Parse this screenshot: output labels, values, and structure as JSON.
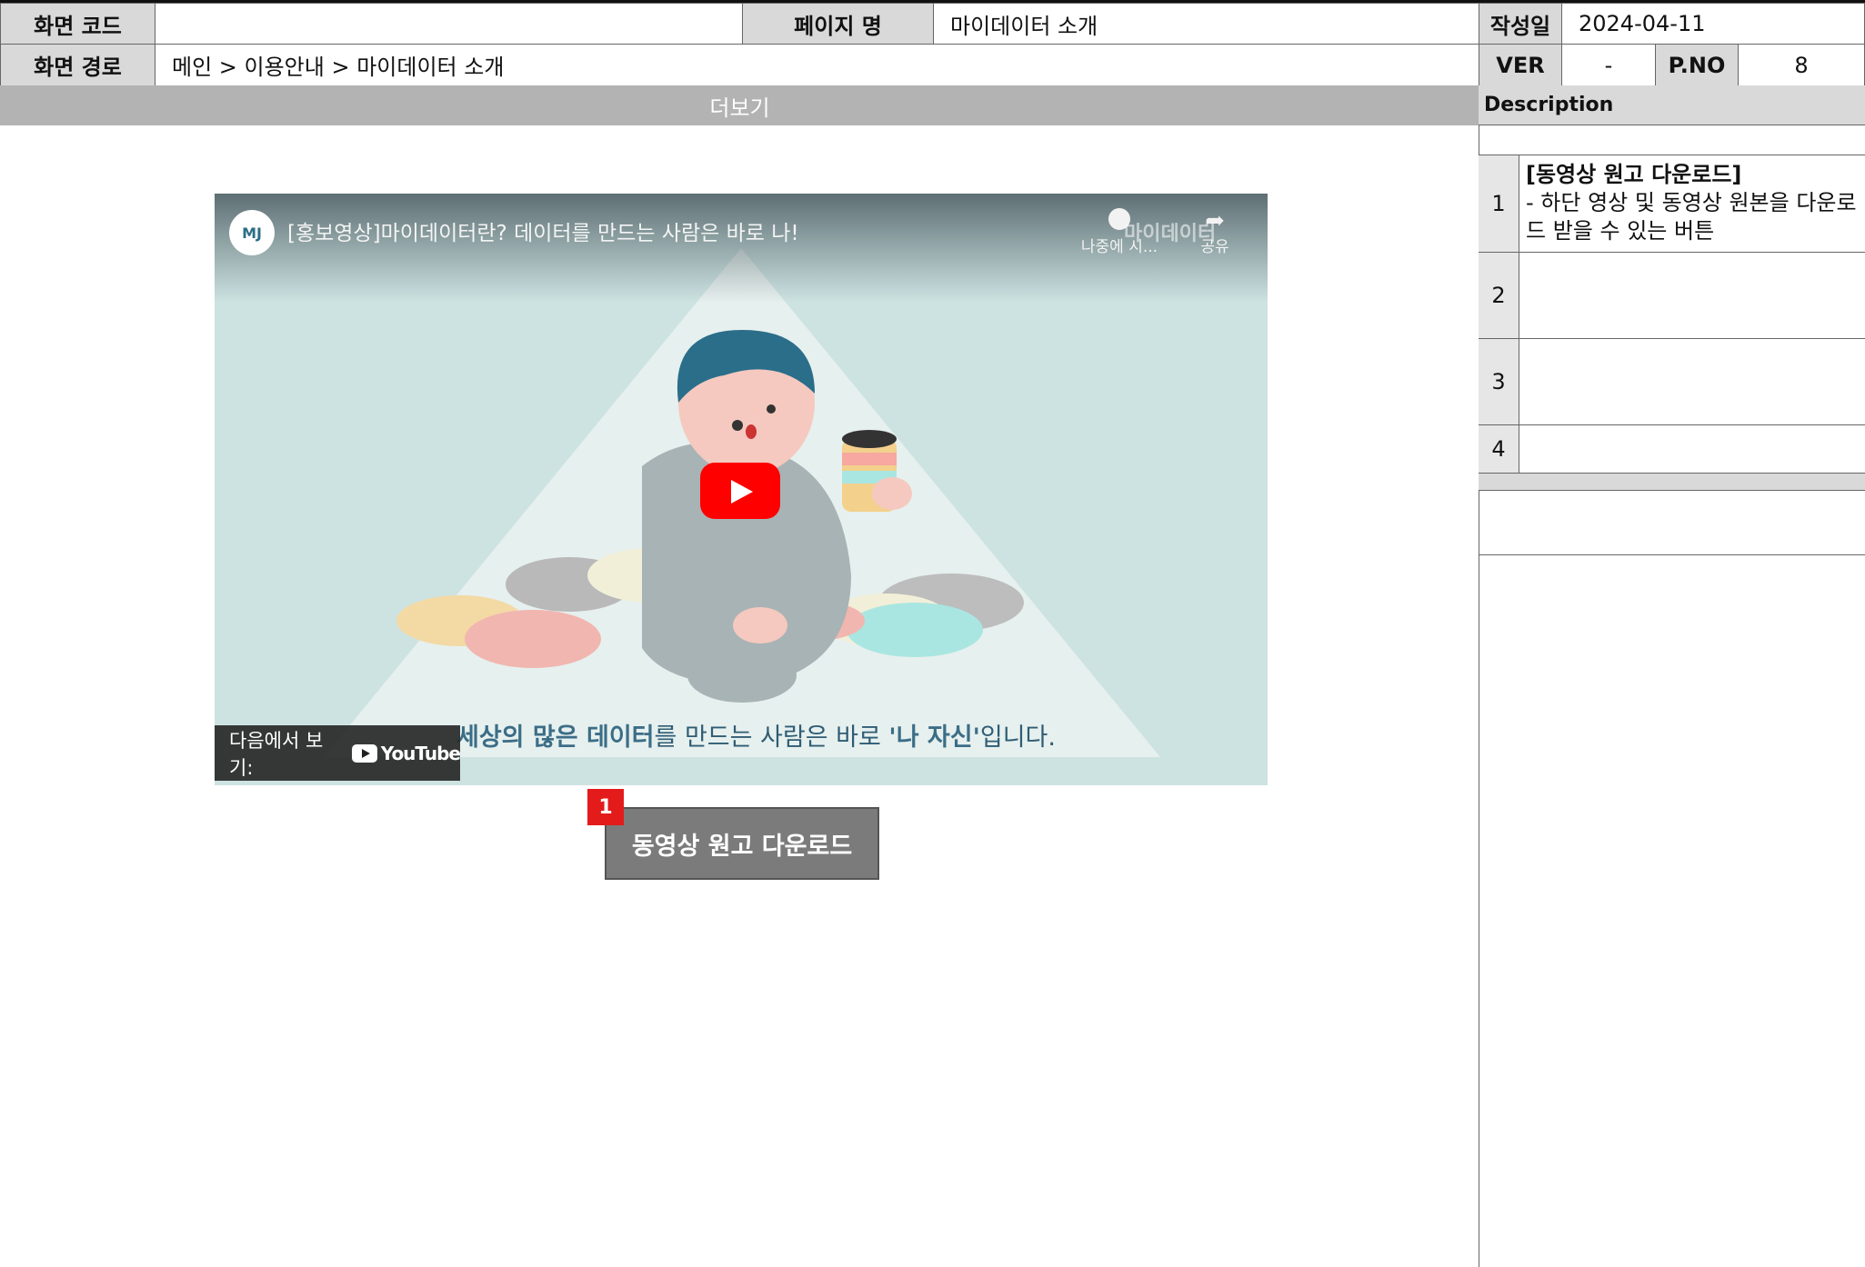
{
  "header": {
    "screen_code_label": "화면 코드",
    "screen_code_value": "",
    "page_name_label": "페이지 명",
    "page_name_value": "마이데이터 소개",
    "date_label": "작성일",
    "date_value": "2024-04-11",
    "path_label": "화면 경로",
    "path_value": "메인 > 이용안내 > 마이데이터 소개",
    "ver_label": "VER",
    "ver_value": "-",
    "pno_label": "P.NO",
    "pno_value": "8"
  },
  "section_title": "더보기",
  "description": {
    "title": "Description",
    "items": [
      {
        "num": "1",
        "heading": "[동영상 원고 다운로드]",
        "text": "- 하단 영상 및 동영상 원본을 다운로드 받을 수 있는 버튼"
      },
      {
        "num": "2",
        "heading": "",
        "text": ""
      },
      {
        "num": "3",
        "heading": "",
        "text": ""
      },
      {
        "num": "4",
        "heading": "",
        "text": ""
      }
    ]
  },
  "video": {
    "channel_logo": "MJ",
    "title": "[홍보영상]마이데이터란? 데이터를 만드는 사람은 바로 나!",
    "watch_later_label": "나중에 시...",
    "share_label": "공유",
    "watermark": "마이데이터",
    "watch_on_label": "다음에서 보기:",
    "youtube_label": "YouTube",
    "subtitle_bold1": "세상의 많은 데이터",
    "subtitle_plain1": "를 만드는 사람은 바로 ",
    "subtitle_bold2": "'나 자신'",
    "subtitle_plain2": "입니다."
  },
  "download_button": {
    "label": "동영상 원고 다운로드",
    "marker": "1"
  },
  "colors": {
    "header_bg": "#d9d9d9",
    "section_bar_bg": "#b3b3b3",
    "button_bg": "#7b7b7b",
    "marker_red": "#e31b1b",
    "play_red": "#ff0000"
  }
}
